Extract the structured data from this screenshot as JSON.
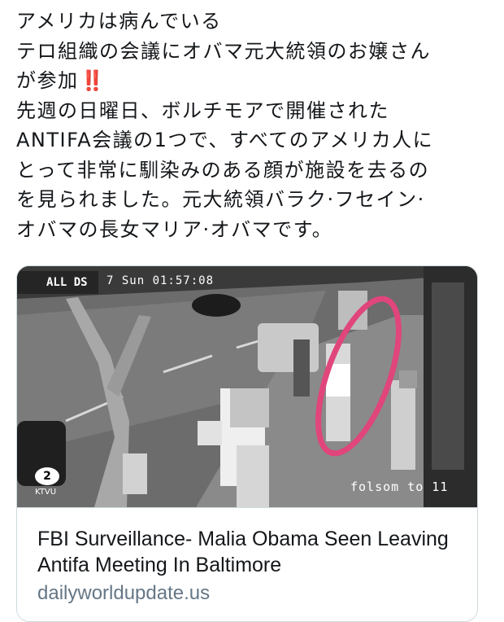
{
  "tweet": {
    "lines": [
      "アメリカは病んでいる",
      "テロ組織の会議にオバマ元大統領のお嬢さん",
      "が参加",
      "先週の日曜日、ボルチモアで開催された",
      "ANTIFA会議の1つで、すべてのアメリカ人に",
      "とって非常に馴染みのある顔が施設を去るの",
      "を見られました。元大統領バラク·フセイン·",
      "オバマの長女マリア·オバマです。"
    ],
    "emoji": "‼️"
  },
  "card": {
    "media": {
      "timestamp": "7 Sun 01:57:08",
      "logo_text": "ALL DS",
      "street_label": "folsom to 11",
      "station_label": "KTVU",
      "highlight_color": "#e0457b"
    },
    "title": "FBI Surveillance- Malia Obama Seen Leaving Antifa Meeting In Baltimore",
    "domain": "dailyworldupdate.us"
  }
}
